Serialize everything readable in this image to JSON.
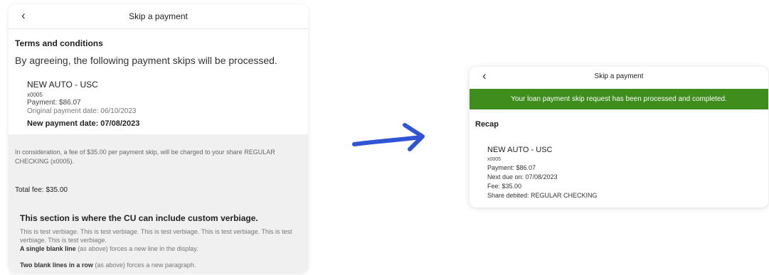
{
  "left": {
    "header": {
      "back_icon": "‹",
      "title": "Skip a payment"
    },
    "terms_title": "Terms and conditions",
    "agree_text": "By agreeing, the following payment skips will be processed.",
    "loan": {
      "name": "NEW AUTO - USC",
      "account": "x0005",
      "payment": "Payment: $86.07",
      "original_date": "Original payment date: 06/10/2023",
      "new_date": "New payment date: 07/08/2023"
    },
    "consideration": "In consideration, a fee of $35.00 per payment skip, will be charged to your share REGULAR CHECKING (x0005).",
    "total_fee": "Total fee: $35.00",
    "custom": {
      "title": "This section is where the CU can include custom verbiage.",
      "body1": "This is test verbiage. This is test verbiage. This is test verbiage. This is test verbiage. This is test verbiage. This is test verbiage.",
      "line_bold": "A single blank line",
      "line_rest": " (as above) forces a new line in the display.",
      "para_bold": "Two blank lines in a row",
      "para_rest": " (as above) forces a new paragraph."
    }
  },
  "right": {
    "header": {
      "back_icon": "‹",
      "title": "Skip a payment"
    },
    "success_message": "Your loan payment skip request has been processed and completed.",
    "recap_title": "Recap",
    "loan": {
      "name": "NEW AUTO - USC",
      "account": "x0005",
      "payment": "Payment: $86.07",
      "next_due": "Next due on: 07/08/2023",
      "fee": "Fee: $35.00",
      "share_debited": "Share debited: REGULAR CHECKING"
    }
  },
  "colors": {
    "success": "#3e8d1d",
    "arrow": "#2f55d4"
  }
}
